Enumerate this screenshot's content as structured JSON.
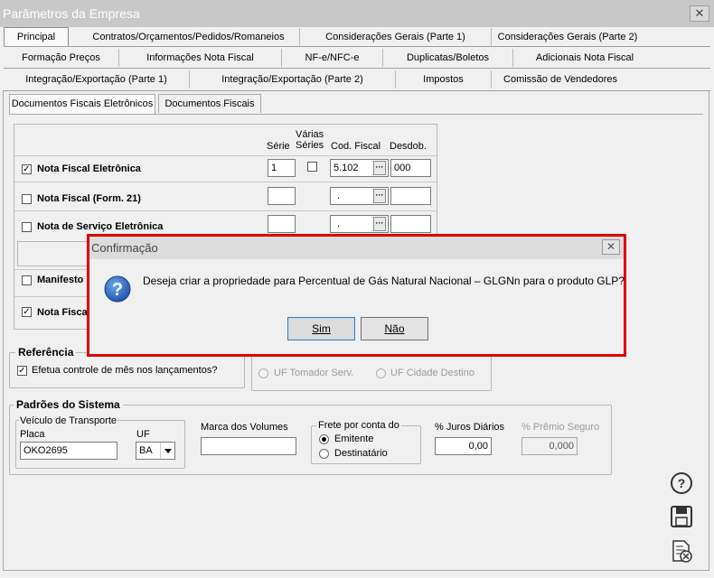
{
  "window": {
    "title": "Parâmetros da Empresa",
    "close_glyph": "✕"
  },
  "tabs": {
    "row1": [
      "Principal",
      "Contratos/Orçamentos/Pedidos/Romaneios",
      "Considerações Gerais (Parte 1)",
      "Considerações Gerais (Parte 2)"
    ],
    "row2": [
      "Formação Preços",
      "Informações Nota Fiscal",
      "NF-e/NFC-e",
      "Duplicatas/Boletos",
      "Adicionais Nota Fiscal"
    ],
    "row3": [
      "Integração/Exportação (Parte 1)",
      "Integração/Exportação (Parte 2)",
      "Impostos",
      "Comissão de Vendedores"
    ],
    "active": "Principal"
  },
  "subtabs": {
    "items": [
      "Documentos Fiscais Eletrônicos",
      "Documentos Fiscais"
    ],
    "active": "Documentos Fiscais Eletrônicos"
  },
  "doc_table": {
    "headers": {
      "serie": "Série",
      "varias_series": "Várias Séries",
      "varias_1": "Várias",
      "varias_2": "Séries",
      "cod_fiscal": "Cod. Fiscal",
      "desdob": "Desdob."
    },
    "rows": [
      {
        "label": "Nota Fiscal Eletrônica",
        "checked": true,
        "serie": "1",
        "varias": false,
        "cod_fiscal": "5.102",
        "desdob": "000"
      },
      {
        "label": "Nota Fiscal (Form. 21)",
        "checked": false,
        "serie": "",
        "cod_fiscal": ".",
        "desdob": ""
      },
      {
        "label": "Nota de Serviço Eletrônica",
        "checked": false,
        "serie": "",
        "cod_fiscal": ".",
        "desdob": ""
      },
      {
        "label": "Manifesto",
        "checked": false
      },
      {
        "label": "Nota Fisca",
        "checked": true
      }
    ],
    "check_glyph": "✓",
    "dots": "···"
  },
  "referencia": {
    "title": "Referência",
    "checkbox_label": "Efetua controle de mês nos lançamentos?",
    "checked": true
  },
  "uf_options": {
    "tomador": "UF Tomador Serv.",
    "destino": "UF Cidade Destino"
  },
  "padroes": {
    "title": "Padrões do Sistema",
    "veiculo": {
      "title": "Veículo de Transporte",
      "placa_label": "Placa",
      "placa": "OKO2695",
      "uf_label": "UF",
      "uf": "BA"
    },
    "marca_label": "Marca dos Volumes",
    "marca": "",
    "frete": {
      "title": "Frete por conta do",
      "options": [
        "Emitente",
        "Destinatário"
      ],
      "selected": "Emitente"
    },
    "juros_label": "% Juros Diários",
    "juros": "0,00",
    "premio_label": "% Prêmio Seguro",
    "premio": "0,000"
  },
  "dialog": {
    "title": "Confirmação",
    "message": "Deseja criar a propriedade para Percentual de Gás Natural Nacional –  GLGNn para o produto GLP?",
    "yes": "Sim",
    "no": "Não",
    "icon": "question-icon",
    "close_glyph": "✕"
  },
  "side_icons": [
    "help-icon",
    "save-icon",
    "cancel-document-icon"
  ],
  "colors": {
    "dialog_border": "#e00000",
    "titlebar": "#c8c8c8"
  }
}
